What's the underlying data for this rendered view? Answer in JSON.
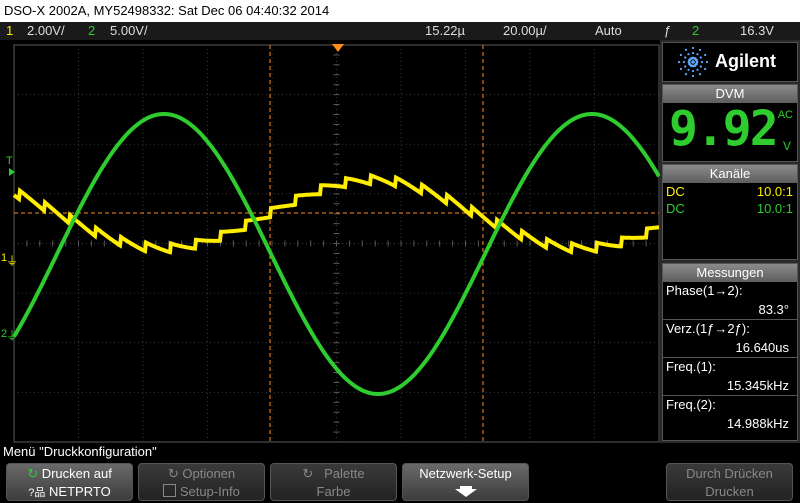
{
  "title": "DSO-X 2002A, MY52498332: Sat Dec 06 04:40:32 2014",
  "status": {
    "ch1_num": "1",
    "ch1_scale": "2.00V/",
    "ch2_num": "2",
    "ch2_scale": "5.00V/",
    "time_offset": "15.22µ",
    "time_base": "20.00µ/",
    "trigger_mode": "Auto",
    "trigger_icon": "ƒ",
    "trigger_source": "2",
    "trigger_level": "16.3V"
  },
  "colors": {
    "ch1": "#ffee00",
    "ch2": "#2ecc2e",
    "marker": "#ff8c1a"
  },
  "screen": {
    "trigger_marker": "T",
    "ch1_marker": "1",
    "ch2_marker": "2"
  },
  "panel": {
    "brand": "Agilent",
    "dvm": {
      "title": "DVM",
      "value": "9.92",
      "mode": "AC",
      "unit": "V"
    },
    "channels": {
      "title": "Kanäle",
      "rows": [
        {
          "coupling": "DC",
          "probe": "10.0:1"
        },
        {
          "coupling": "DC",
          "probe": "10.0:1"
        }
      ]
    },
    "measurements": {
      "title": "Messungen",
      "items": [
        {
          "label": "Phase(1→2):",
          "value": "83.3°"
        },
        {
          "label": "Verz.(1ƒ→2ƒ):",
          "value": "16.640us"
        },
        {
          "label": "Freq.(1):",
          "value": "15.345kHz"
        },
        {
          "label": "Freq.(2):",
          "value": "14.988kHz"
        }
      ]
    }
  },
  "menu": {
    "title": "Menü \"Druckkonfiguration\"",
    "softkeys": [
      {
        "line1": "Drucken auf",
        "line2": "NETPRTO"
      },
      {
        "line1": "Optionen",
        "line2": "Setup-Info"
      },
      {
        "line1": "Palette",
        "line2": "Farbe"
      },
      {
        "line1": "Netzwerk-Setup",
        "line2": ""
      },
      {
        "line1": "Durch Drücken",
        "line2": "Drucken"
      }
    ]
  }
}
